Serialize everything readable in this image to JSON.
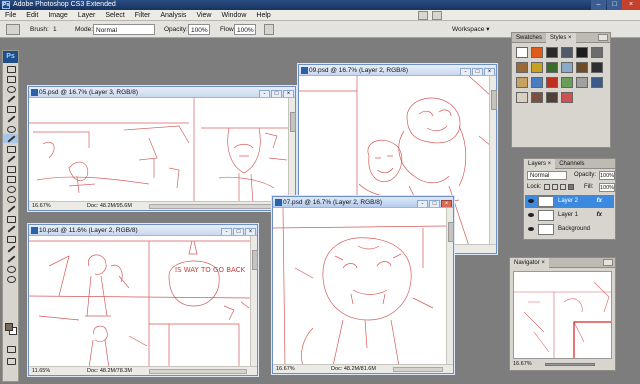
{
  "titlebar": {
    "title": "Adobe Photoshop CS3 Extended",
    "app_icon_text": "Ps"
  },
  "menu": [
    "File",
    "Edit",
    "Image",
    "Layer",
    "Select",
    "Filter",
    "Analysis",
    "View",
    "Window",
    "Help"
  ],
  "options_bar": {
    "brush_label": "Brush:",
    "brush_size": "1",
    "mode_label": "Mode:",
    "mode_value": "Normal",
    "opacity_label": "Opacity:",
    "opacity_value": "100%",
    "flow_label": "Flow:",
    "flow_value": "100%",
    "workspace_label": "Workspace ▾"
  },
  "tools": {
    "logo": "Ps",
    "foreground_color": "#7a6a58",
    "background_color": "#ffffff"
  },
  "documents": [
    {
      "id": "doc-05",
      "title": "05.psd @ 16.7% (Layer 3, RGB/8)",
      "zoom": "16.67%",
      "size": "Doc: 48.2M/95.6M",
      "active": false
    },
    {
      "id": "doc-09",
      "title": "09.psd @ 16.7% (Layer 2, RGB/8)",
      "zoom": "",
      "size": "",
      "active": false
    },
    {
      "id": "doc-10",
      "title": "10.psd @ 11.6% (Layer 2, RGB/8)",
      "zoom": "11.65%",
      "size": "Doc: 48.2M/78.3M",
      "active": false
    },
    {
      "id": "doc-07",
      "title": "07.psd @ 16.7% (Layer 2, RGB/8)",
      "zoom": "16.67%",
      "size": "Doc: 48.2M/81.6M",
      "active": true
    }
  ],
  "sketch_text": {
    "sign": "IS WAY TO GO BACK"
  },
  "swatches_panel": {
    "tabs": [
      "Swatches",
      "Styles ×"
    ],
    "styles": [
      "#ffffff",
      "#e05a1a",
      "#2a2a2a",
      "#505a68",
      "#1c1c1c",
      "#6c6c6c",
      "#9a6a3a",
      "#c9a020",
      "#3c6c2c",
      "#8aa8c8",
      "#6e4c28",
      "#303030",
      "#c8a060",
      "#4a7cc0",
      "#c03020",
      "#6a9c5a",
      "#a0a0a0",
      "#3a5a8a",
      "#d8d0c0",
      "#7a5040",
      "#504038",
      "#d05050"
    ]
  },
  "layers_panel": {
    "tabs": [
      "Layers ×",
      "Channels"
    ],
    "blend_mode": "Normal",
    "opacity_label": "Opacity:",
    "opacity_value": "100%",
    "lock_label": "Lock:",
    "fill_label": "Fill:",
    "fill_value": "100%",
    "layers": [
      {
        "name": "Layer 2",
        "selected": true,
        "fx": "fx"
      },
      {
        "name": "Layer 1",
        "selected": false,
        "fx": "fx"
      },
      {
        "name": "Background",
        "selected": false,
        "fx": ""
      }
    ]
  },
  "navigator_panel": {
    "tab": "Navigator ×",
    "zoom": "16.67%"
  }
}
